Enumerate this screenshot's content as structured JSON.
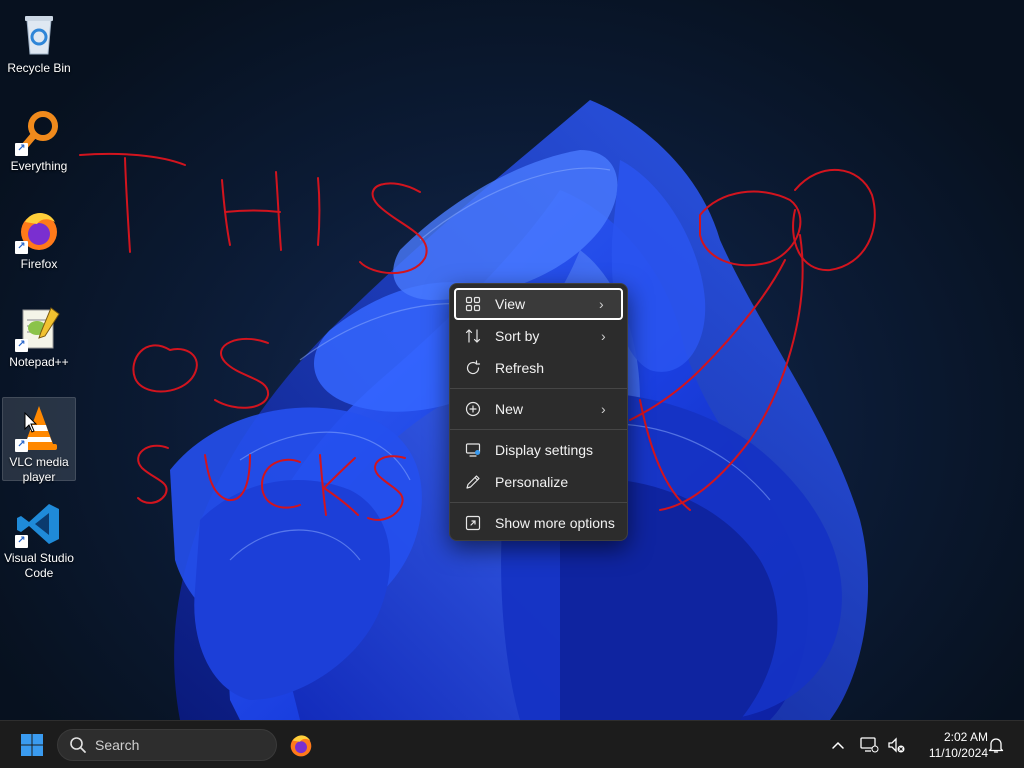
{
  "desktop": {
    "icons": [
      {
        "label": "Recycle Bin",
        "icon": "recycle-bin-icon"
      },
      {
        "label": "Everything",
        "icon": "everything-search-icon"
      },
      {
        "label": "Firefox",
        "icon": "firefox-icon"
      },
      {
        "label": "Notepad++",
        "icon": "notepad-plus-plus-icon"
      },
      {
        "label": "VLC media player",
        "icon": "vlc-icon"
      },
      {
        "label": "Visual Studio Code",
        "icon": "vscode-icon"
      }
    ],
    "scribble_color": "#d2141e"
  },
  "context_menu": {
    "items": [
      {
        "label": "View",
        "icon": "grid-view-icon",
        "submenu": true
      },
      {
        "label": "Sort by",
        "icon": "sort-icon",
        "submenu": true
      },
      {
        "label": "Refresh",
        "icon": "refresh-icon",
        "submenu": false
      },
      {
        "label": "New",
        "icon": "new-plus-icon",
        "submenu": true
      },
      {
        "label": "Display settings",
        "icon": "display-settings-icon",
        "submenu": false
      },
      {
        "label": "Personalize",
        "icon": "pen-icon",
        "submenu": false
      },
      {
        "label": "Show more options",
        "icon": "more-options-icon",
        "submenu": false
      }
    ]
  },
  "taskbar": {
    "search_placeholder": "Search",
    "clock_time": "2:02 AM",
    "clock_date": "11/10/2024",
    "accent": "#3a9bf0"
  }
}
